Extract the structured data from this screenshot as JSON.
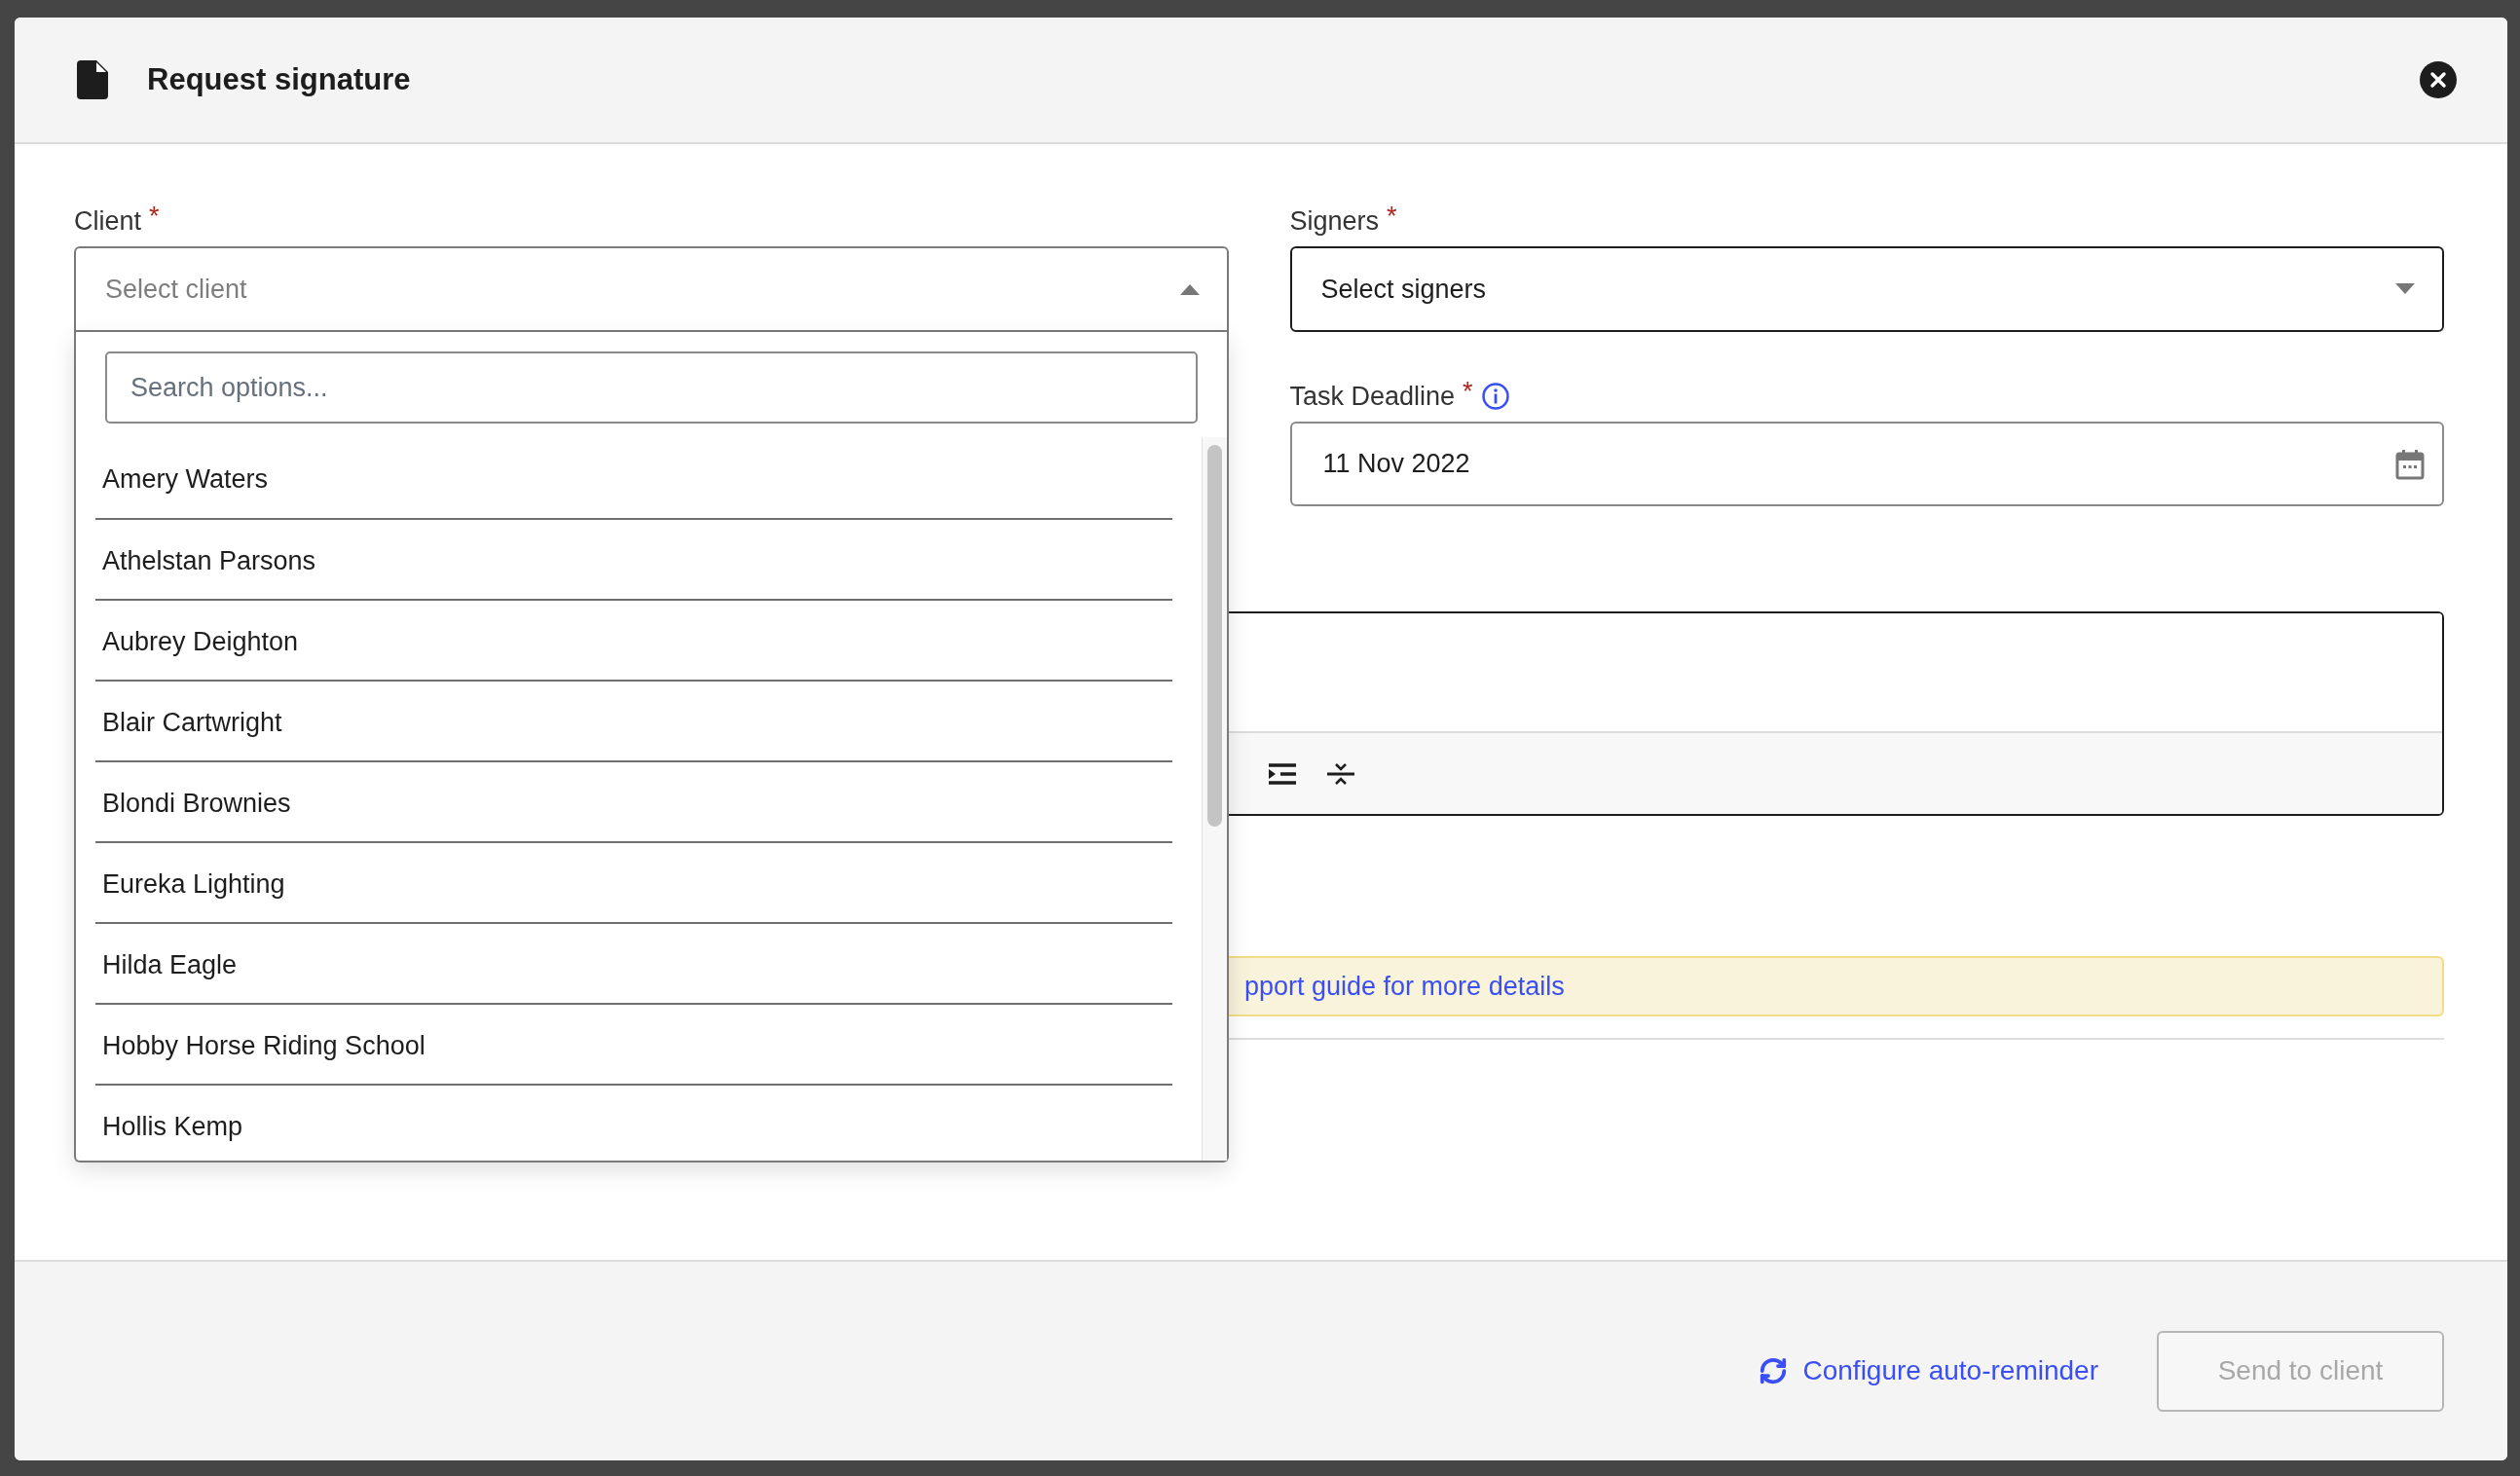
{
  "dialog": {
    "title": "Request signature"
  },
  "client": {
    "label": "Client",
    "required_mark": "*",
    "placeholder": "Select client",
    "expanded": true,
    "search": {
      "placeholder": "Search options..."
    },
    "options": [
      "Amery Waters",
      "Athelstan Parsons",
      "Aubrey Deighton",
      "Blair Cartwright",
      "Blondi Brownies",
      "Eureka Lighting",
      "Hilda Eagle",
      "Hobby Horse Riding School",
      "Hollis Kemp"
    ]
  },
  "signers": {
    "label": "Signers",
    "required_mark": "*",
    "placeholder": "Select signers",
    "expanded": false
  },
  "deadline": {
    "label": "Task Deadline",
    "required_mark": "*",
    "value": "11 Nov 2022"
  },
  "notice": {
    "text": "pport guide for more details"
  },
  "footer": {
    "link": "Configure auto-reminder",
    "button": {
      "label": "Send to client",
      "disabled": true
    }
  }
}
